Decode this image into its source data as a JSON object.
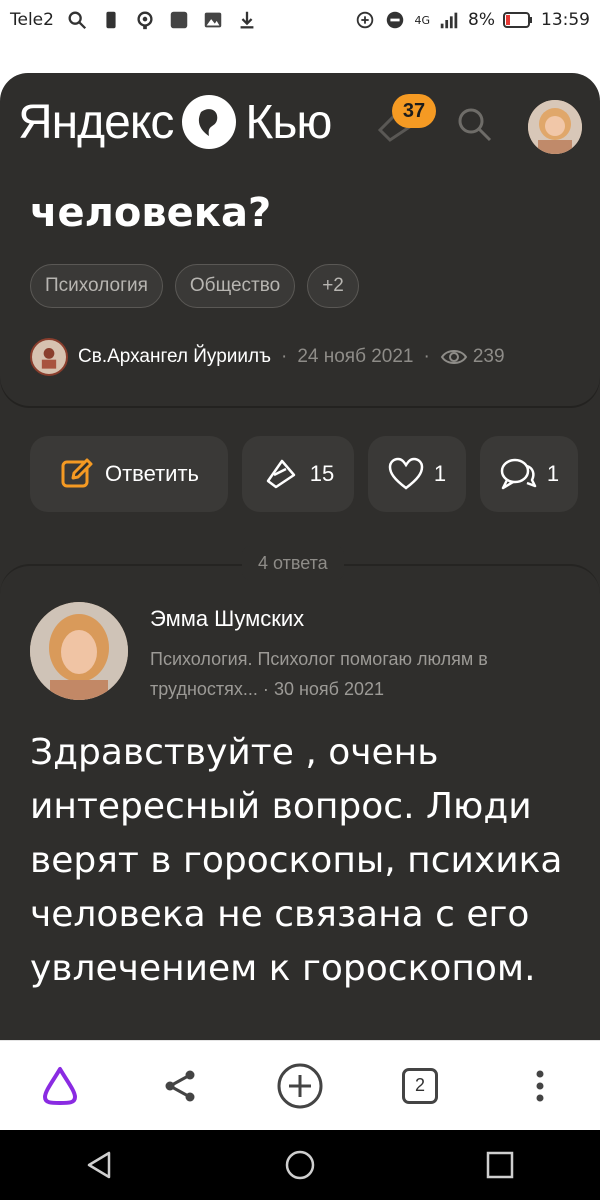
{
  "status_bar": {
    "carrier": "Tele2",
    "battery_percent": "8%",
    "time": "13:59",
    "network": "4G"
  },
  "header": {
    "logo_left": "Яндекс",
    "logo_right": "Кью",
    "notification_count": "37",
    "icons": [
      "logo-mark-icon",
      "bell-icon",
      "search-icon",
      "avatar"
    ]
  },
  "question": {
    "title": "человека?",
    "tags": [
      "Психология",
      "Общество",
      "+2"
    ],
    "author": "Св.Архангел Йуриилъ",
    "separator": "·",
    "date": "24 нояб 2021",
    "views": "239"
  },
  "actions": {
    "reply_label": "Ответить",
    "upvotes": "15",
    "likes": "1",
    "comments": "1"
  },
  "answers": {
    "count_label": "4 ответа",
    "first": {
      "author": "Эмма Шумских",
      "description": "Психология. Психолог помогаю люлям в трудностях...",
      "separator": "·",
      "date": "30 нояб 2021",
      "text": "Здравствуйте , очень интересный вопрос. Люди верят в гороскопы, психика человека не связана с его увлечением к гороскопом."
    }
  },
  "toolbar": {
    "tab_count": "2",
    "icons": [
      "alice-icon",
      "share-icon",
      "add-icon",
      "tabs-icon",
      "more-icon"
    ]
  },
  "navbar": {
    "icons": [
      "back-icon",
      "home-icon",
      "recents-icon"
    ]
  },
  "colors": {
    "background": "#2f2e2c",
    "surface": "#3a3937",
    "accent": "#f59a23",
    "alice": "#8a2be2"
  }
}
